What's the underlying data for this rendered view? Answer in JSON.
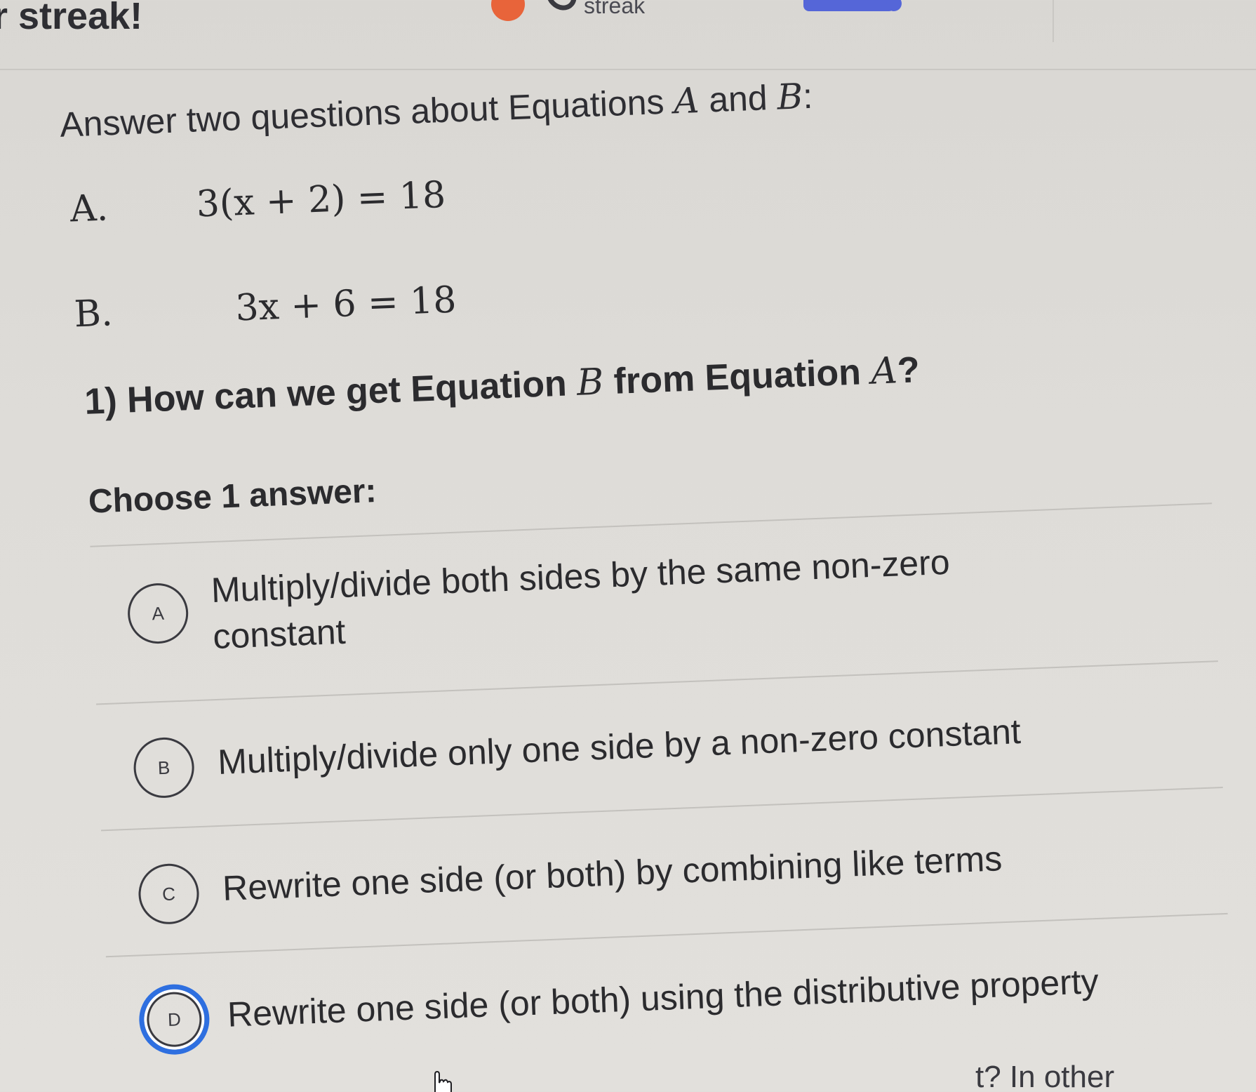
{
  "topbar": {
    "title": "r streak!",
    "streak_label": "streak"
  },
  "intro": {
    "text_before": "Answer two questions about Equations ",
    "var_a": "A",
    "text_and": " and ",
    "var_b": "B",
    "text_after": ":"
  },
  "equations": [
    {
      "label": "A.",
      "expression": "3(x + 2) = 18"
    },
    {
      "label": "B.",
      "expression": "3x + 6 = 18"
    }
  ],
  "question": {
    "prefix": "1) How can we get Equation ",
    "var_b": "B",
    "middle": " from Equation ",
    "var_a": "A",
    "suffix": "?"
  },
  "choose_label": "Choose 1 answer:",
  "choices": [
    {
      "letter": "A",
      "line1": "Multiply/divide both sides by the same non-zero",
      "line2": "constant",
      "selected": false
    },
    {
      "letter": "B",
      "line1": "Multiply/divide only one side by a non-zero constant",
      "line2": "",
      "selected": false
    },
    {
      "letter": "C",
      "line1": "Rewrite one side (or both) by combining like terms",
      "line2": "",
      "selected": false
    },
    {
      "letter": "D",
      "line1": "Rewrite one side (or both) using the distributive property",
      "line2": "",
      "selected": true
    }
  ],
  "partial_text": "t? In other",
  "icons": {
    "streak": "streak-flame-icon",
    "cursor": "hand-pointer-icon"
  },
  "colors": {
    "accent": "#2e6fe0",
    "progress": "#5566d8",
    "streak": "#e8643a"
  }
}
